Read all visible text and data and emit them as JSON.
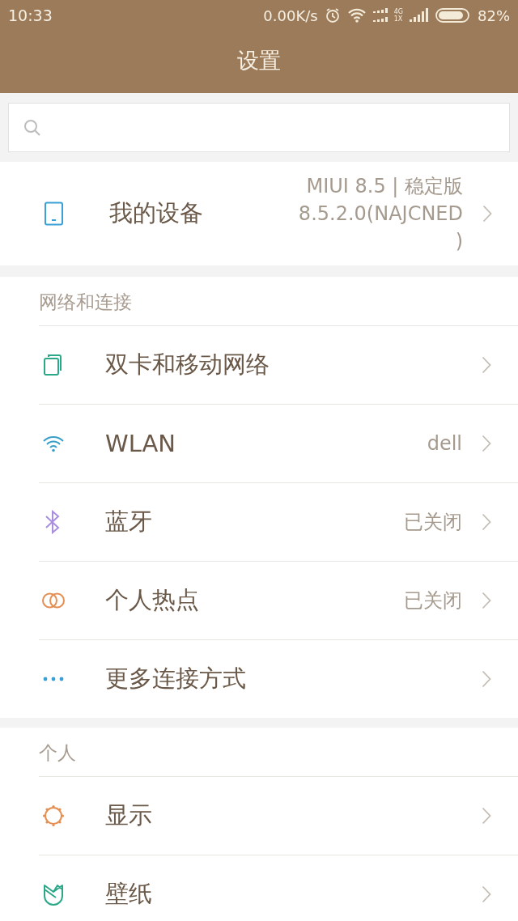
{
  "status_bar": {
    "time": "10:33",
    "speed": "0.00K/s",
    "network_top": "4G",
    "network_bottom": "1X",
    "battery": "82%"
  },
  "title": "设置",
  "device": {
    "label": "我的设备",
    "value_lines": [
      "MIUI 8.5 | 稳定版",
      "8.5.2.0(NAJCNED",
      ")"
    ]
  },
  "sections": [
    {
      "title": "网络和连接",
      "items": [
        {
          "kind": "sim",
          "label": "双卡和移动网络"
        },
        {
          "kind": "wifi",
          "label": "WLAN",
          "value": "dell"
        },
        {
          "kind": "bluetooth",
          "label": "蓝牙",
          "value": "已关闭"
        },
        {
          "kind": "hotspot",
          "label": "个人热点",
          "value": "已关闭"
        },
        {
          "kind": "more",
          "label": "更多连接方式"
        }
      ]
    },
    {
      "title": "个人",
      "items": [
        {
          "kind": "display",
          "label": "显示"
        },
        {
          "kind": "wallpaper",
          "label": "壁纸"
        }
      ]
    }
  ]
}
